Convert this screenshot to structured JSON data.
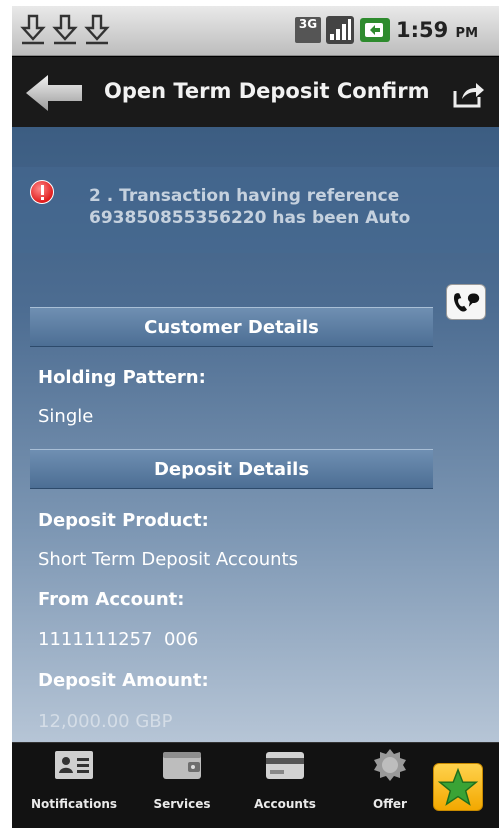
{
  "status_bar": {
    "network": "3G",
    "time": "1:59",
    "ampm": "PM"
  },
  "title_bar": {
    "title": "Open Term Deposit Confirm"
  },
  "message": {
    "line1": "2 . Transaction having reference",
    "line2": "693850855356220 has been Auto"
  },
  "customer_details": {
    "header": "Customer Details",
    "holding_pattern_label": "Holding Pattern:",
    "holding_pattern_value": "Single"
  },
  "deposit_details": {
    "header": "Deposit Details",
    "deposit_product_label": "Deposit Product:",
    "deposit_product_value": "Short Term Deposit Accounts",
    "from_account_label": "From Account:",
    "from_account_value": "1111111257  006",
    "deposit_amount_label": "Deposit Amount:",
    "deposit_amount_value": "12,000.00 GBP"
  },
  "bottom_nav": {
    "items": [
      {
        "label": "Notifications",
        "icon": "contact-card-icon"
      },
      {
        "label": "Services",
        "icon": "wallet-icon"
      },
      {
        "label": "Accounts",
        "icon": "credit-card-icon"
      },
      {
        "label": "Offer",
        "icon": "gear-badge-icon"
      }
    ],
    "favorite_icon": "star-icon"
  },
  "colors": {
    "content_top": "#3c5d82",
    "content_bottom": "#b6c5d6",
    "section_header": "#5a7da3",
    "alert": "#e01c1c",
    "favorite": "#f3a800"
  }
}
